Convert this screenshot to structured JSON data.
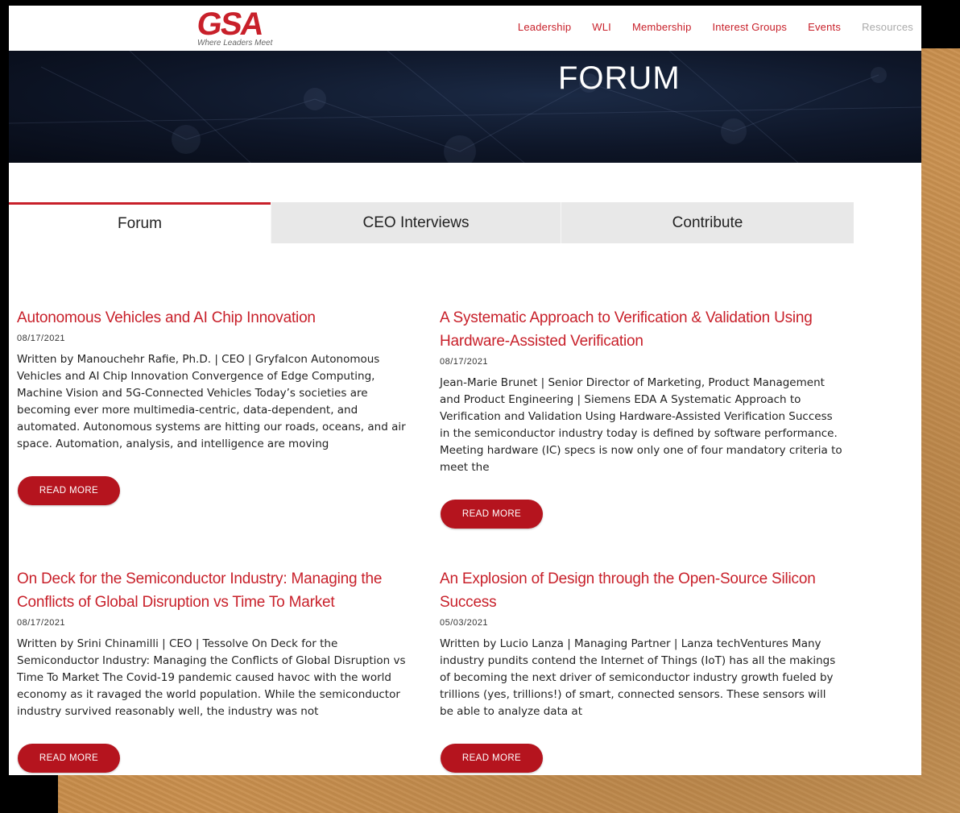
{
  "brand": {
    "logo_text": "GSA",
    "tagline": "Where Leaders Meet"
  },
  "nav": {
    "items": [
      "Leadership",
      "WLI",
      "Membership",
      "Interest Groups",
      "Events",
      "Resources"
    ]
  },
  "hero": {
    "title": "FORUM"
  },
  "tabs": [
    {
      "label": "Forum",
      "active": true
    },
    {
      "label": "CEO Interviews",
      "active": false
    },
    {
      "label": "Contribute",
      "active": false
    }
  ],
  "articles": [
    {
      "title": "Autonomous Vehicles and AI Chip Innovation",
      "date": "08/17/2021",
      "excerpt": "Written by Manouchehr Rafie, Ph.D.  | CEO | Gryfalcon Autonomous Vehicles and AI Chip Innovation Convergence of Edge Computing, Machine Vision and 5G-Connected Vehicles Today’s societies are becoming ever more multimedia-centric, data-dependent, and automated. Autonomous systems are hitting our roads, oceans, and air space. Automation, analysis, and intelligence are moving",
      "button": "READ MORE"
    },
    {
      "title": "A Systematic Approach to Verification & Validation Using Hardware-Assisted Verification",
      "date": "08/17/2021",
      "excerpt": "Jean-Marie Brunet | Senior Director of Marketing, Product Management and Product Engineering | Siemens EDA A Systematic Approach to Verification and Validation Using Hardware-Assisted Verification Success in the semiconductor industry today is defined by software performance. Meeting hardware (IC) specs is now only one of four mandatory criteria to meet the",
      "button": "READ MORE"
    },
    {
      "title": "On Deck for the Semiconductor Industry: Managing the Conflicts of Global Disruption vs Time To Market",
      "date": "08/17/2021",
      "excerpt": "Written by Srini Chinamilli | CEO | Tessolve On Deck for the Semiconductor Industry: Managing the Conflicts of Global Disruption vs Time To Market The Covid-19 pandemic caused havoc with the world economy as it ravaged the world population. While the semiconductor industry survived reasonably well, the industry was not",
      "button": "READ MORE"
    },
    {
      "title": "An Explosion of Design through the Open-Source Silicon Success",
      "date": "05/03/2021",
      "excerpt": "Written by Lucio Lanza | Managing Partner | Lanza techVentures Many industry pundits contend the Internet of Things (IoT) has all the makings of becoming the next driver of semiconductor industry growth fueled by trillions (yes, trillions!) of smart, connected sensors. These sensors will be able to analyze data at",
      "button": "READ MORE"
    }
  ],
  "colors": {
    "brand_red": "#c8202a",
    "button_red": "#b5141e",
    "hero_navy": "#0e1628"
  }
}
